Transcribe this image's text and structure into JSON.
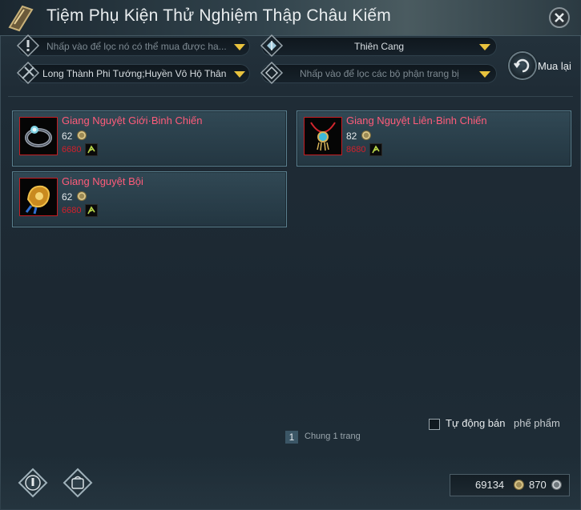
{
  "window": {
    "title": "Tiệm Phụ Kiện Thử Nghiệm Thập Châu Kiếm"
  },
  "filters": {
    "purchasable": {
      "placeholder": "Nhấp vào để lọc nó có thể mua được ha..."
    },
    "sect": {
      "value": "Thiên Cang"
    },
    "set": {
      "value": "Long Thành Phi Tướng;Huyền Vô Hộ Thân"
    },
    "slot": {
      "placeholder": "Nhấp vào để lọc các bộ phận trang bị"
    }
  },
  "buyback": {
    "label": "Mua lại"
  },
  "items": [
    {
      "name": "Giang Nguyệt Giới·Binh Chiến",
      "price": "62",
      "original_price": "6680",
      "icon": "ring-icon"
    },
    {
      "name": "Giang Nguyệt Liên·Binh Chiến",
      "price": "82",
      "original_price": "8680",
      "icon": "necklace-icon"
    },
    {
      "name": "Giang Nguyệt Bội",
      "price": "62",
      "original_price": "6680",
      "icon": "pendant-icon"
    }
  ],
  "autosell": {
    "label": "Tự động bán",
    "suffix": "phế phẩm",
    "checked": false
  },
  "pager": {
    "current": "1",
    "total": "Chung 1 trang"
  },
  "currency": {
    "gold": "69134",
    "silver": "870"
  },
  "colors": {
    "item_name": "#ff5c7a",
    "original_price": "#d21f2a",
    "dropdown_arrow": "#e8c23d",
    "card_border": "#5a7f8e"
  }
}
